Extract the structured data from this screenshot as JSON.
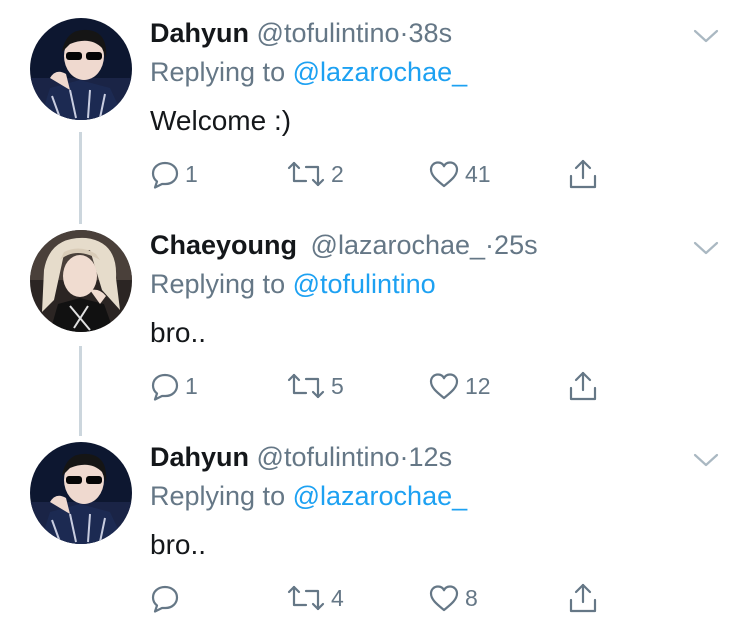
{
  "tweets": [
    {
      "name": "Dahyun",
      "handle": "@tofulintino",
      "separator": "·",
      "time": "38s",
      "replying_prefix": "Replying to",
      "replying_to": "@lazarochae_",
      "text": "Welcome :)",
      "replies": "1",
      "retweets": "2",
      "likes": "41",
      "avatar": "dahyun-avatar"
    },
    {
      "name": "Chaeyoung",
      "handle": "@lazarochae_",
      "separator": "·",
      "time": "25s",
      "replying_prefix": "Replying to",
      "replying_to": "@tofulintino",
      "text": "bro..",
      "replies": "1",
      "retweets": "5",
      "likes": "12",
      "avatar": "chaeyoung-avatar"
    },
    {
      "name": "Dahyun",
      "handle": "@tofulintino",
      "separator": "·",
      "time": "12s",
      "replying_prefix": "Replying to",
      "replying_to": "@lazarochae_",
      "text": "bro..",
      "replies": "",
      "retweets": "4",
      "likes": "8",
      "avatar": "dahyun-avatar"
    }
  ],
  "colors": {
    "text": "#14171a",
    "muted": "#657786",
    "link": "#1da1f2",
    "thread_line": "#ccd6dd"
  },
  "icons": [
    "reply-icon",
    "retweet-icon",
    "like-icon",
    "share-icon",
    "chevron-down-icon"
  ]
}
